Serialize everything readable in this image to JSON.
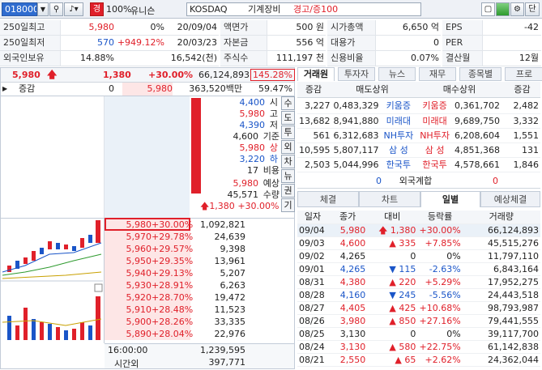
{
  "toolbar": {
    "code": "018000",
    "percent": "100%",
    "name": "유니슨",
    "market": "KOSDAQ",
    "sector": "기계장비",
    "warning": "경고/증100",
    "tab_label": "단",
    "gyeong": "경"
  },
  "info": {
    "r1": {
      "l1": "250일최고",
      "v1": "5,980",
      "p1": "0%",
      "d1": "20/09/04",
      "l2": "액면가",
      "v2": "500 원",
      "l3": "시가총액",
      "v3": "6,650 억",
      "l4": "EPS",
      "v4": "-42"
    },
    "r2": {
      "l1": "250일최저",
      "v1": "570",
      "p1": "+949.12%",
      "d1": "20/03/23",
      "l2": "자본금",
      "v2": "556 억",
      "l3": "대용가",
      "v3": "0",
      "l4": "PER",
      "v4": ""
    },
    "r3": {
      "l1": "외국인보유",
      "v1": "14.88%",
      "p1": "16,542(천)",
      "l2": "주식수",
      "v2": "111,197 천",
      "l3": "신용비율",
      "v3": "0.07%",
      "l4": "결산월",
      "v4": "12월"
    }
  },
  "quote": {
    "price": "5,980",
    "change": "1,380",
    "rate": "+30.00%",
    "volume": "66,124,893",
    "vol_rate": "145.28%",
    "net_label": "증감",
    "net_val": "0",
    "net_price": "5,980",
    "amount": "363,520백만",
    "ratio": "59.47%"
  },
  "summary": [
    {
      "val": "4,400",
      "lbl": "시"
    },
    {
      "val": "5,980",
      "lbl": "고"
    },
    {
      "val": "4,390",
      "lbl": "저"
    },
    {
      "val": "4,600",
      "lbl": "기준"
    },
    {
      "val": "5,980",
      "lbl": "상"
    },
    {
      "val": "3,220",
      "lbl": "하"
    },
    {
      "val": "17",
      "lbl": "비용"
    },
    {
      "val": "5,980",
      "lbl": "예상"
    },
    {
      "val": "45,571",
      "lbl": "수량"
    },
    {
      "val": "1,380",
      "lbl": "+30.00%"
    }
  ],
  "side_buttons": [
    "수",
    "도",
    "투",
    "외",
    "차",
    "뉴",
    "권",
    "기"
  ],
  "bids": [
    {
      "price": "5,980",
      "rate": "+30.00%",
      "qty": "1,092,821"
    },
    {
      "price": "5,970",
      "rate": "+29.78%",
      "qty": "24,639"
    },
    {
      "price": "5,960",
      "rate": "+29.57%",
      "qty": "9,398"
    },
    {
      "price": "5,950",
      "rate": "+29.35%",
      "qty": "13,961"
    },
    {
      "price": "5,940",
      "rate": "+29.13%",
      "qty": "5,207"
    },
    {
      "price": "5,930",
      "rate": "+28.91%",
      "qty": "6,263"
    },
    {
      "price": "5,920",
      "rate": "+28.70%",
      "qty": "19,472"
    },
    {
      "price": "5,910",
      "rate": "+28.48%",
      "qty": "11,523"
    },
    {
      "price": "5,900",
      "rate": "+28.26%",
      "qty": "33,335"
    },
    {
      "price": "5,890",
      "rate": "+28.04%",
      "qty": "22,976"
    }
  ],
  "bottom": {
    "time": "16:00:00",
    "qty_total": "1,239,595",
    "after_label": "시간외",
    "after_qty": "397,771"
  },
  "right_tabs": [
    "거래원",
    "투자자",
    "뉴스",
    "재무",
    "종목별",
    "프로"
  ],
  "trades_head": {
    "c1": "증감",
    "c2": "매도상위",
    "c3": "매수상위",
    "c4": "증감"
  },
  "trades": [
    {
      "s_chg": "3,227",
      "s_qty": "0,483,329",
      "s_name": "키움증",
      "b_name": "키움증",
      "b_qty": "0,361,702",
      "b_chg": "2,482"
    },
    {
      "s_chg": "13,682",
      "s_qty": "8,941,880",
      "s_name": "미래대",
      "b_name": "미래대",
      "b_qty": "9,689,750",
      "b_chg": "3,332"
    },
    {
      "s_chg": "561",
      "s_qty": "6,312,683",
      "s_name": "NH투자",
      "b_name": "NH투자",
      "b_qty": "6,208,604",
      "b_chg": "1,551"
    },
    {
      "s_chg": "10,595",
      "s_qty": "5,807,117",
      "s_name": "삼 성",
      "b_name": "삼 성",
      "b_qty": "4,851,368",
      "b_chg": "131"
    },
    {
      "s_chg": "2,503",
      "s_qty": "5,044,996",
      "s_name": "한국투",
      "b_name": "한국투",
      "b_qty": "4,578,661",
      "b_chg": "1,846"
    }
  ],
  "foreign": {
    "s": "0",
    "label": "외국계합",
    "b": "0"
  },
  "lower_tabs": [
    "체결",
    "차트",
    "일별",
    "예상체결"
  ],
  "daily_head": {
    "date": "일자",
    "close": "종가",
    "chg": "대비",
    "rate": "등락률",
    "vol": "거래량"
  },
  "daily": [
    {
      "date": "09/04",
      "close": "5,980",
      "dir": "up-limit",
      "chg": "1,380",
      "rate": "+30.00%",
      "vol": "66,124,893"
    },
    {
      "date": "09/03",
      "close": "4,600",
      "dir": "up",
      "chg": "335",
      "rate": "+7.85%",
      "vol": "45,515,276"
    },
    {
      "date": "09/02",
      "close": "4,265",
      "dir": "none",
      "chg": "0",
      "rate": "0%",
      "vol": "11,797,110"
    },
    {
      "date": "09/01",
      "close": "4,265",
      "dir": "down",
      "chg": "115",
      "rate": "-2.63%",
      "vol": "6,843,164"
    },
    {
      "date": "08/31",
      "close": "4,380",
      "dir": "up",
      "chg": "220",
      "rate": "+5.29%",
      "vol": "17,952,275"
    },
    {
      "date": "08/28",
      "close": "4,160",
      "dir": "down",
      "chg": "245",
      "rate": "-5.56%",
      "vol": "24,443,518"
    },
    {
      "date": "08/27",
      "close": "4,405",
      "dir": "up",
      "chg": "425",
      "rate": "+10.68%",
      "vol": "98,793,987"
    },
    {
      "date": "08/26",
      "close": "3,980",
      "dir": "up",
      "chg": "850",
      "rate": "+27.16%",
      "vol": "79,441,555"
    },
    {
      "date": "08/25",
      "close": "3,130",
      "dir": "none",
      "chg": "0",
      "rate": "0%",
      "vol": "39,117,700"
    },
    {
      "date": "08/24",
      "close": "3,130",
      "dir": "up",
      "chg": "580",
      "rate": "+22.75%",
      "vol": "61,142,838"
    },
    {
      "date": "08/21",
      "close": "2,550",
      "dir": "up",
      "chg": "65",
      "rate": "+2.62%",
      "vol": "24,362,044"
    }
  ],
  "colors": {
    "up": "#e0202a",
    "down": "#1a55c8",
    "bid_bg": "#fde6e6",
    "accent_bg": "#eaf1f8"
  }
}
